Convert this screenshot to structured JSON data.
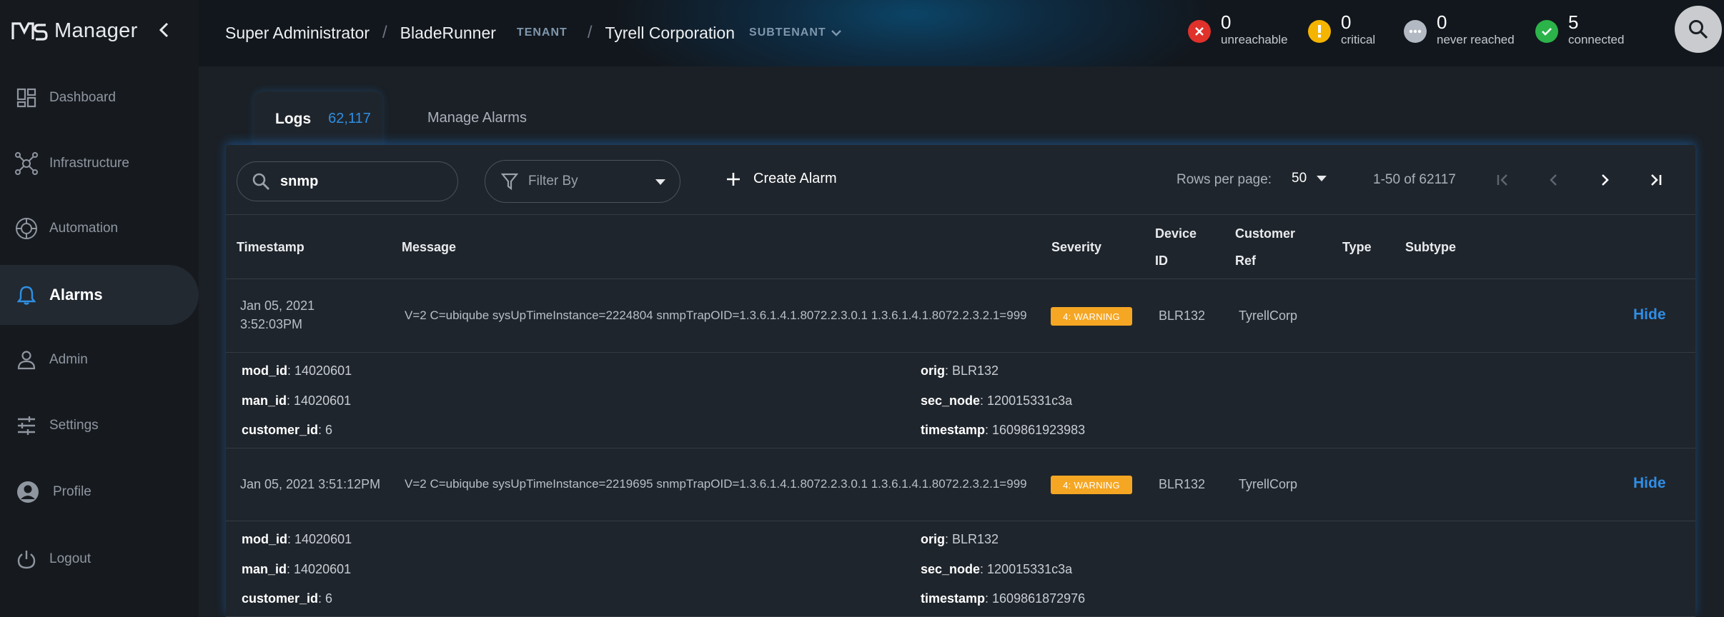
{
  "app": {
    "name": "Manager",
    "colors": {
      "accent": "#2e8fe3",
      "warning": "#f5a623",
      "error": "#e0312b",
      "success": "#2cb34a"
    }
  },
  "sidebar": {
    "items": [
      {
        "label": "Dashboard",
        "icon": "dashboard-icon"
      },
      {
        "label": "Infrastructure",
        "icon": "infrastructure-icon"
      },
      {
        "label": "Automation",
        "icon": "automation-icon"
      },
      {
        "label": "Alarms",
        "icon": "bell-icon",
        "active": true
      },
      {
        "label": "Admin",
        "icon": "person-icon"
      },
      {
        "label": "Settings",
        "icon": "sliders-icon"
      },
      {
        "label": "Profile",
        "icon": "profile-icon"
      },
      {
        "label": "Logout",
        "icon": "power-icon"
      }
    ]
  },
  "header": {
    "user": "Super Administrator",
    "tenant": "BladeRunner",
    "tenant_tag": "TENANT",
    "subtenant": "Tyrell Corporation",
    "subtenant_tag": "SUBTENANT",
    "statuses": [
      {
        "count": "0",
        "label": "unreachable"
      },
      {
        "count": "0",
        "label": "critical"
      },
      {
        "count": "0",
        "label": "never reached"
      },
      {
        "count": "5",
        "label": "connected"
      }
    ]
  },
  "tabs": {
    "logs_label": "Logs",
    "logs_count": "62,117",
    "alarms_label": "Manage Alarms"
  },
  "toolbar": {
    "search_value": "snmp",
    "filter_label": "Filter By",
    "create_alarm_label": "Create Alarm",
    "rows_per_page_label": "Rows per page:",
    "rows_per_page_value": "50",
    "range": "1-50 of 62117"
  },
  "table": {
    "headers": {
      "timestamp": "Timestamp",
      "message": "Message",
      "severity": "Severity",
      "device_id_1": "Device",
      "device_id_2": "ID",
      "customer_ref_1": "Customer",
      "customer_ref_2": "Ref",
      "type": "Type",
      "subtype": "Subtype"
    },
    "rows": [
      {
        "timestamp_line1": "Jan 05, 2021",
        "timestamp_line2": "3:52:03PM",
        "message": "V=2 C=ubiqube sysUpTimeInstance=2224804 snmpTrapOID=1.3.6.1.4.1.8072.2.3.0.1 1.3.6.1.4.1.8072.2.3.2.1=999",
        "severity": "4: WARNING",
        "device_id": "BLR132",
        "customer_ref": "TyrellCorp",
        "action": "Hide",
        "details": {
          "mod_id_key": "mod_id",
          "mod_id": ": 14020601",
          "man_id_key": "man_id",
          "man_id": ": 14020601",
          "customer_id_key": "customer_id",
          "customer_id": ": 6",
          "orig_key": "orig",
          "orig": ": BLR132",
          "sec_node_key": "sec_node",
          "sec_node": ": 120015331c3a",
          "timestamp_key": "timestamp",
          "timestamp": ": 1609861923983"
        }
      },
      {
        "timestamp_line1": "Jan 05, 2021 3:51:12PM",
        "timestamp_line2": "",
        "message": "V=2 C=ubiqube sysUpTimeInstance=2219695 snmpTrapOID=1.3.6.1.4.1.8072.2.3.0.1 1.3.6.1.4.1.8072.2.3.2.1=999",
        "severity": "4: WARNING",
        "device_id": "BLR132",
        "customer_ref": "TyrellCorp",
        "action": "Hide",
        "details": {
          "mod_id_key": "mod_id",
          "mod_id": ": 14020601",
          "man_id_key": "man_id",
          "man_id": ": 14020601",
          "customer_id_key": "customer_id",
          "customer_id": ": 6",
          "orig_key": "orig",
          "orig": ": BLR132",
          "sec_node_key": "sec_node",
          "sec_node": ": 120015331c3a",
          "timestamp_key": "timestamp",
          "timestamp": ": 1609861872976"
        }
      }
    ]
  }
}
